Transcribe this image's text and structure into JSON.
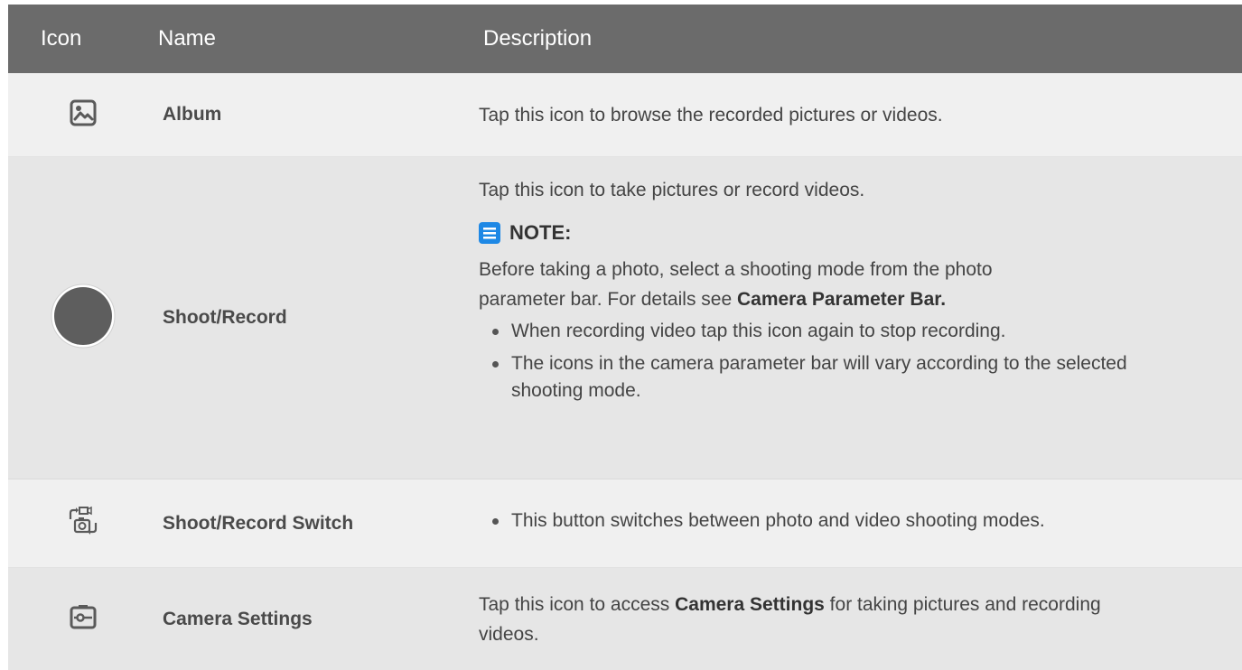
{
  "header": {
    "col_icon": "Icon",
    "col_name": "Name",
    "col_desc": "Description"
  },
  "rows": [
    {
      "icon": "album-icon",
      "name": "Album",
      "desc": "Tap this icon to browse the recorded pictures or videos."
    },
    {
      "icon": "shoot-record-icon",
      "name": "Shoot/Record",
      "desc": "Tap this icon to take pictures or record videos.",
      "note_label": "NOTE:",
      "note_text_before": "Before taking a photo, select a shooting mode from the photo parameter bar. For details see ",
      "note_link": "Camera Parameter Bar.",
      "bullets": [
        "When recording video tap this icon again to stop recording.",
        "The icons in the camera parameter bar will vary according to the selected shooting mode."
      ]
    },
    {
      "icon": "shoot-record-switch-icon",
      "name": "Shoot/Record Switch",
      "bullets": [
        "This button switches between photo and video shooting modes."
      ]
    },
    {
      "icon": "camera-settings-icon",
      "name": "Camera Settings",
      "desc_before": "Tap this icon to access ",
      "desc_bold": "Camera Settings",
      "desc_after": " for taking pictures and recording videos."
    }
  ],
  "colors": {
    "header_bg": "#6b6b6b",
    "note_icon": "#1e88e5",
    "icon_gray": "#5a5a5a"
  }
}
